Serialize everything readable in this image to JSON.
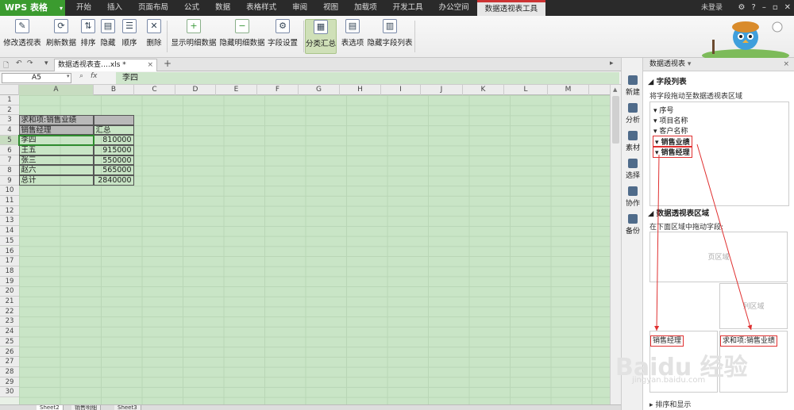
{
  "app": {
    "name": "WPS 表格"
  },
  "menu": {
    "tabs": [
      "开始",
      "插入",
      "页面布局",
      "公式",
      "数据",
      "表格样式",
      "审阅",
      "视图",
      "加载项",
      "开发工具",
      "办公空间",
      "数据透视表工具"
    ],
    "active_index": 11,
    "login": "未登录"
  },
  "ribbon": {
    "buttons": [
      "修改透视表",
      "刷新数据",
      "排序",
      "隐藏",
      "顺序",
      "删除",
      "显示明细数据",
      "隐藏明细数据",
      "字段设置",
      "分类汇总",
      "表选项",
      "隐藏字段列表"
    ]
  },
  "document": {
    "tab_title": "数据透视表查….xls *"
  },
  "formula": {
    "cell_ref": "A5",
    "fx": "fx",
    "value": "李四"
  },
  "sheet": {
    "columns": [
      "A",
      "B",
      "C",
      "D",
      "E",
      "F",
      "G",
      "H",
      "I",
      "J",
      "K",
      "L",
      "M"
    ],
    "rows": [
      "1",
      "2",
      "3",
      "4",
      "5",
      "6",
      "7",
      "8",
      "9",
      "10",
      "11",
      "12",
      "13",
      "14",
      "15",
      "16",
      "17",
      "18",
      "19",
      "20",
      "21",
      "22",
      "23",
      "24",
      "25",
      "26",
      "27",
      "28",
      "29",
      "30"
    ],
    "pivot_title": "求和项:销售业绩",
    "row_field": "销售经理",
    "sum_header": "汇总",
    "records": [
      {
        "name": "李四",
        "value": "810000"
      },
      {
        "name": "王五",
        "value": "915000"
      },
      {
        "name": "张三",
        "value": "550000"
      },
      {
        "name": "赵六",
        "value": "565000"
      },
      {
        "name": "总计",
        "value": "2840000"
      }
    ],
    "tabs": [
      "Sheet2",
      "销售明细",
      "Sheet3"
    ]
  },
  "side_tools": [
    "新建",
    "分析",
    "素材",
    "选择",
    "协作",
    "备份"
  ],
  "pivot_pane": {
    "title": "数据透视表",
    "field_list_header": "字段列表",
    "drag_hint": "将字段拖动至数据透视表区域",
    "fields": [
      "序号",
      "项目名称",
      "客户名称",
      "销售业绩",
      "销售经理"
    ],
    "area_header": "数据透视表区域",
    "area_hint": "在下面区域中拖动字段:",
    "page_area": "页区域",
    "col_area": "列区域",
    "row_chip": "销售经理",
    "data_chip": "求和项:销售业绩",
    "sort_section": "排序和显示"
  },
  "watermark": {
    "text": "Baidu 经验",
    "url": "jingyan.baidu.com"
  }
}
